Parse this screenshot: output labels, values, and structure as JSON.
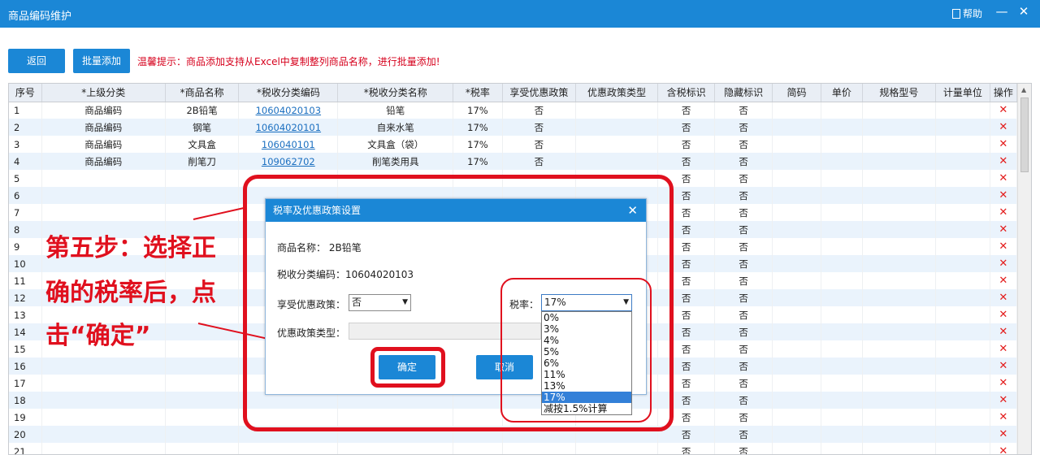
{
  "window": {
    "title": "商品编码维护",
    "help_label": "帮助",
    "min_glyph": "—",
    "close_glyph": "✕"
  },
  "toolbar": {
    "back_label": "返回",
    "batch_add_label": "批量添加",
    "tip": "温馨提示：商品添加支持从Excel中复制整列商品名称，进行批量添加!"
  },
  "table": {
    "headers": [
      "序号",
      "*上级分类",
      "*商品名称",
      "*税收分类编码",
      "*税收分类名称",
      "*税率",
      "享受优惠政策",
      "优惠政策类型",
      "含税标识",
      "隐藏标识",
      "简码",
      "单价",
      "规格型号",
      "计量单位",
      "操作"
    ],
    "rows": [
      {
        "seq": "1",
        "parent": "商品编码",
        "name": "2B铅笔",
        "code": "10604020103",
        "cname": "铅笔",
        "rate": "17%",
        "pref": "否",
        "ptype": "",
        "tax": "否",
        "hidden": "否"
      },
      {
        "seq": "2",
        "parent": "商品编码",
        "name": "钢笔",
        "code": "10604020101",
        "cname": "自来水笔",
        "rate": "17%",
        "pref": "否",
        "ptype": "",
        "tax": "否",
        "hidden": "否"
      },
      {
        "seq": "3",
        "parent": "商品编码",
        "name": "文具盒",
        "code": "106040101",
        "cname": "文具盒（袋）",
        "rate": "17%",
        "pref": "否",
        "ptype": "",
        "tax": "否",
        "hidden": "否"
      },
      {
        "seq": "4",
        "parent": "商品编码",
        "name": "削笔刀",
        "code": "109062702",
        "cname": "削笔类用具",
        "rate": "17%",
        "pref": "否",
        "ptype": "",
        "tax": "否",
        "hidden": "否"
      },
      {
        "seq": "5",
        "parent": "",
        "name": "",
        "code": "",
        "cname": "",
        "rate": "",
        "pref": "",
        "ptype": "",
        "tax": "否",
        "hidden": "否"
      },
      {
        "seq": "6",
        "parent": "",
        "name": "",
        "code": "",
        "cname": "",
        "rate": "",
        "pref": "",
        "ptype": "",
        "tax": "否",
        "hidden": "否"
      },
      {
        "seq": "7",
        "parent": "",
        "name": "",
        "code": "",
        "cname": "",
        "rate": "",
        "pref": "",
        "ptype": "",
        "tax": "否",
        "hidden": "否"
      },
      {
        "seq": "8",
        "parent": "",
        "name": "",
        "code": "",
        "cname": "",
        "rate": "",
        "pref": "",
        "ptype": "",
        "tax": "否",
        "hidden": "否"
      },
      {
        "seq": "9",
        "parent": "",
        "name": "",
        "code": "",
        "cname": "",
        "rate": "",
        "pref": "",
        "ptype": "",
        "tax": "否",
        "hidden": "否"
      },
      {
        "seq": "10",
        "parent": "",
        "name": "",
        "code": "",
        "cname": "",
        "rate": "",
        "pref": "",
        "ptype": "",
        "tax": "否",
        "hidden": "否"
      },
      {
        "seq": "11",
        "parent": "",
        "name": "",
        "code": "",
        "cname": "",
        "rate": "",
        "pref": "",
        "ptype": "",
        "tax": "否",
        "hidden": "否"
      },
      {
        "seq": "12",
        "parent": "",
        "name": "",
        "code": "",
        "cname": "",
        "rate": "",
        "pref": "",
        "ptype": "",
        "tax": "否",
        "hidden": "否"
      },
      {
        "seq": "13",
        "parent": "",
        "name": "",
        "code": "",
        "cname": "",
        "rate": "",
        "pref": "",
        "ptype": "",
        "tax": "否",
        "hidden": "否"
      },
      {
        "seq": "14",
        "parent": "",
        "name": "",
        "code": "",
        "cname": "",
        "rate": "",
        "pref": "",
        "ptype": "",
        "tax": "否",
        "hidden": "否"
      },
      {
        "seq": "15",
        "parent": "",
        "name": "",
        "code": "",
        "cname": "",
        "rate": "",
        "pref": "",
        "ptype": "",
        "tax": "否",
        "hidden": "否"
      },
      {
        "seq": "16",
        "parent": "",
        "name": "",
        "code": "",
        "cname": "",
        "rate": "",
        "pref": "",
        "ptype": "",
        "tax": "否",
        "hidden": "否"
      },
      {
        "seq": "17",
        "parent": "",
        "name": "",
        "code": "",
        "cname": "",
        "rate": "",
        "pref": "",
        "ptype": "",
        "tax": "否",
        "hidden": "否"
      },
      {
        "seq": "18",
        "parent": "",
        "name": "",
        "code": "",
        "cname": "",
        "rate": "",
        "pref": "",
        "ptype": "",
        "tax": "否",
        "hidden": "否"
      },
      {
        "seq": "19",
        "parent": "",
        "name": "",
        "code": "",
        "cname": "",
        "rate": "",
        "pref": "",
        "ptype": "",
        "tax": "否",
        "hidden": "否"
      },
      {
        "seq": "20",
        "parent": "",
        "name": "",
        "code": "",
        "cname": "",
        "rate": "",
        "pref": "",
        "ptype": "",
        "tax": "否",
        "hidden": "否"
      },
      {
        "seq": "21",
        "parent": "",
        "name": "",
        "code": "",
        "cname": "",
        "rate": "",
        "pref": "",
        "ptype": "",
        "tax": "否",
        "hidden": "否"
      }
    ],
    "delete_glyph": "✕"
  },
  "annotation": {
    "line1": "第五步：选择正",
    "line2": "确的税率后，点",
    "line3": "击“确定”"
  },
  "dialog": {
    "title": "税率及优惠政策设置",
    "close_glyph": "✕",
    "product_name_label": "商品名称：",
    "product_name_value": "2B铅笔",
    "tax_code_label": "税收分类编码：",
    "tax_code_value": "10604020103",
    "pref_label": "享受优惠政策：",
    "pref_value": "否",
    "rate_label": "税率：",
    "rate_value": "17%",
    "pref_type_label": "优惠政策类型：",
    "ok_label": "确定",
    "cancel_label": "取消",
    "rate_options": [
      "0%",
      "3%",
      "4%",
      "5%",
      "6%",
      "11%",
      "13%",
      "17%",
      "减按1.5%计算"
    ],
    "selected_index": 7
  },
  "colors": {
    "titlebar": "#1b87d6",
    "annotation_red": "#e0101e",
    "row_alt": "#eaf3fc",
    "delete_red": "#e31b1b"
  }
}
